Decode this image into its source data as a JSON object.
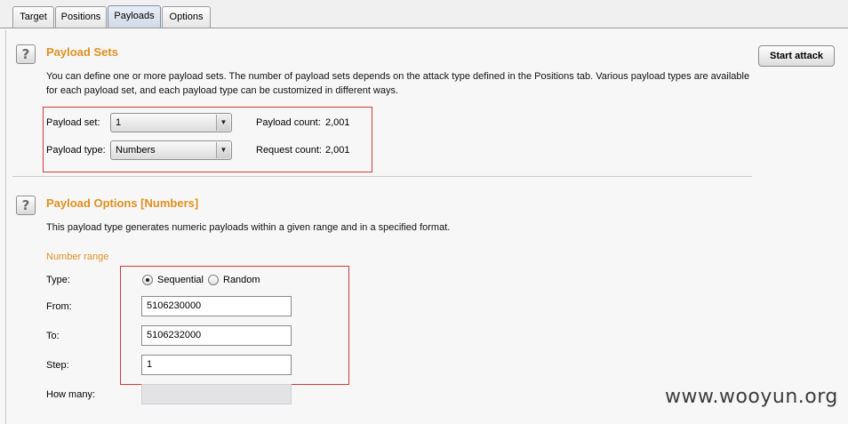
{
  "tabs": {
    "target": "Target",
    "positions": "Positions",
    "payloads": "Payloads",
    "options": "Options",
    "active": "Payloads"
  },
  "help_icon_glyph": "?",
  "payload_sets": {
    "title": "Payload Sets",
    "description_line1": "You can define one or more payload sets. The number of payload sets depends on the attack type defined in the Positions tab. Various payload types are available",
    "description_line2": "for each payload set, and each payload type can be customized in different ways.",
    "payload_set_label": "Payload set:",
    "payload_set_value": "1",
    "payload_type_label": "Payload type:",
    "payload_type_value": "Numbers",
    "payload_count_label": "Payload count:",
    "payload_count_value": "2,001",
    "request_count_label": "Request count:",
    "request_count_value": "2,001"
  },
  "start_attack_label": "Start attack",
  "payload_options": {
    "title": "Payload Options [Numbers]",
    "description": "This payload type generates numeric payloads within a given range and in a specified format.",
    "number_range_heading": "Number range",
    "type_label": "Type:",
    "sequential_label": "Sequential",
    "random_label": "Random",
    "selected_type": "Sequential",
    "from_label": "From:",
    "from_value": "5106230000",
    "to_label": "To:",
    "to_value": "5106232000",
    "step_label": "Step:",
    "step_value": "1",
    "how_many_label": "How many:",
    "how_many_value": ""
  },
  "watermark": "www.wooyun.org",
  "colors": {
    "section_title": "#e0901e",
    "highlight_box": "#d23a3a"
  },
  "icons": {
    "help": "help-icon",
    "dropdown": "chevron-down-icon"
  }
}
